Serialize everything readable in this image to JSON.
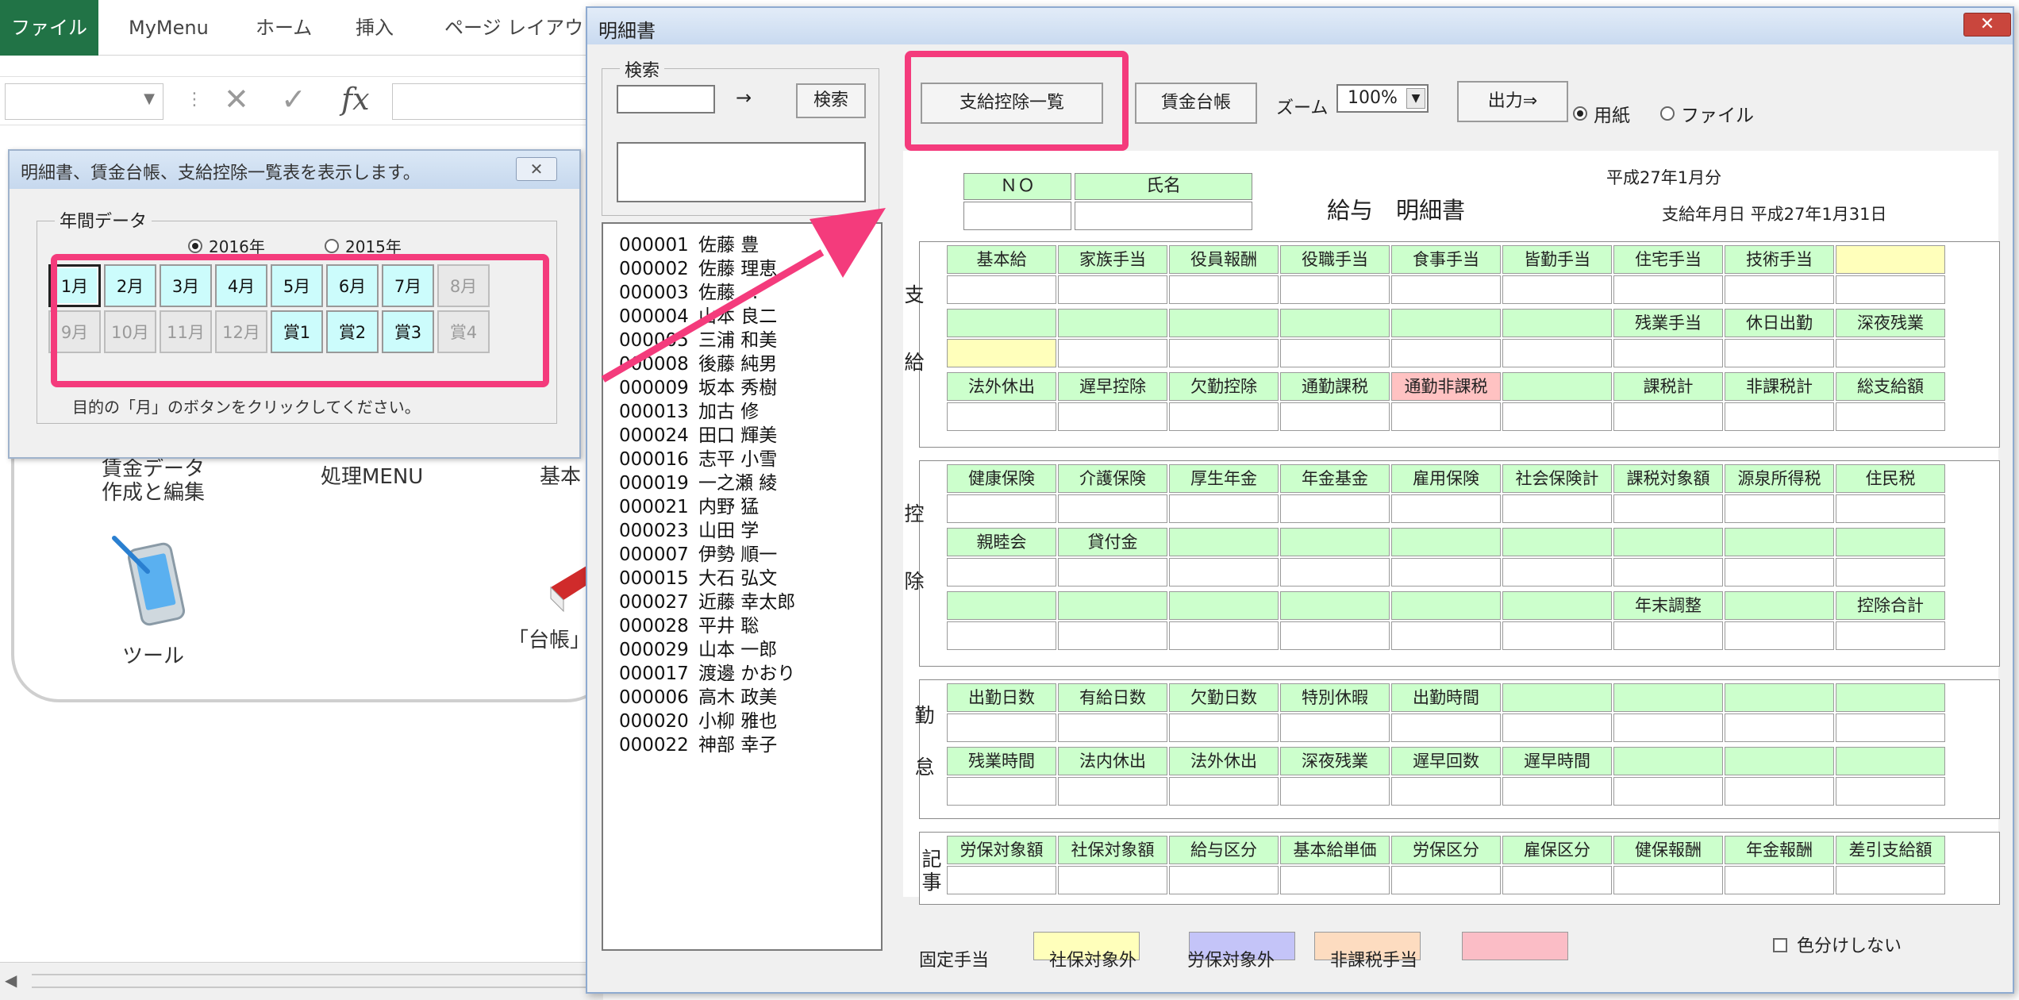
{
  "excel": {
    "ribbon_tabs": [
      "ファイル",
      "MyMenu",
      "ホーム",
      "挿入",
      "ページ レイアウト"
    ],
    "fx_label": "fx",
    "menu_items": {
      "data_edit_line1": "賃金データ",
      "data_edit_line2": "作成と編集",
      "process_menu": "処理MENU",
      "basic_partial": "基本",
      "tool": "ツール",
      "ledger_partial": "「台帳」"
    }
  },
  "small_dialog": {
    "title": "明細書、賃金台帳、支給控除一覧表を表示します。",
    "close_symbol": "✕",
    "group_label": "年間データ",
    "years": [
      {
        "label": "2016年",
        "selected": true
      },
      {
        "label": "2015年",
        "selected": false
      }
    ],
    "months": [
      {
        "label": "1月",
        "enabled": true,
        "selected": true
      },
      {
        "label": "2月",
        "enabled": true,
        "selected": false
      },
      {
        "label": "3月",
        "enabled": true,
        "selected": false
      },
      {
        "label": "4月",
        "enabled": true,
        "selected": false
      },
      {
        "label": "5月",
        "enabled": true,
        "selected": false
      },
      {
        "label": "6月",
        "enabled": true,
        "selected": false
      },
      {
        "label": "7月",
        "enabled": true,
        "selected": false
      },
      {
        "label": "8月",
        "enabled": false,
        "selected": false
      },
      {
        "label": "9月",
        "enabled": false,
        "selected": false
      },
      {
        "label": "10月",
        "enabled": false,
        "selected": false
      },
      {
        "label": "11月",
        "enabled": false,
        "selected": false
      },
      {
        "label": "12月",
        "enabled": false,
        "selected": false
      },
      {
        "label": "賞1",
        "enabled": true,
        "selected": false
      },
      {
        "label": "賞2",
        "enabled": true,
        "selected": false
      },
      {
        "label": "賞3",
        "enabled": true,
        "selected": false
      },
      {
        "label": "賞4",
        "enabled": false,
        "selected": false
      }
    ],
    "hint": "目的の「月」のボタンをクリックしてください。"
  },
  "main_form": {
    "title": "明細書",
    "close_symbol": "✕",
    "search": {
      "group_label": "検索",
      "arrow": "→",
      "button": "検索"
    },
    "employees": [
      {
        "code": "000001",
        "name": "佐藤 豊"
      },
      {
        "code": "000002",
        "name": "佐藤 理恵"
      },
      {
        "code": "000003",
        "name": "佐藤 ..."
      },
      {
        "code": "000004",
        "name": "山本 良二"
      },
      {
        "code": "000005",
        "name": "三浦 和美"
      },
      {
        "code": "000008",
        "name": "後藤 純男"
      },
      {
        "code": "000009",
        "name": "坂本 秀樹"
      },
      {
        "code": "000013",
        "name": "加古 修"
      },
      {
        "code": "000024",
        "name": "田口 輝美"
      },
      {
        "code": "000016",
        "name": "志平 小雪"
      },
      {
        "code": "000019",
        "name": "一之瀬 綾"
      },
      {
        "code": "000021",
        "name": "内野 猛"
      },
      {
        "code": "000023",
        "name": "山田 学"
      },
      {
        "code": "000007",
        "name": "伊勢 順一"
      },
      {
        "code": "000015",
        "name": "大石 弘文"
      },
      {
        "code": "000027",
        "name": "近藤 幸太郎"
      },
      {
        "code": "000028",
        "name": "平井 聡"
      },
      {
        "code": "000029",
        "name": "山本 一郎"
      },
      {
        "code": "000017",
        "name": "渡邊 かおり"
      },
      {
        "code": "000006",
        "name": "高木 政美"
      },
      {
        "code": "000020",
        "name": "小柳 雅也"
      },
      {
        "code": "000022",
        "name": "神部 幸子"
      }
    ],
    "toolbar": {
      "summary_button": "支給控除一覧",
      "ledger_button": "賃金台帳",
      "zoom_label": "ズーム",
      "zoom_value": "100%",
      "output_button": "出力⇒",
      "output_options": [
        {
          "label": "用紙",
          "selected": true
        },
        {
          "label": "ファイル",
          "selected": false
        }
      ]
    },
    "sheet": {
      "no_label": "ＮＯ",
      "name_label": "氏名",
      "doc_type": "給与　明細書",
      "period": "平成27年1月分",
      "pay_date": "支給年月日 平成27年1月31日",
      "sections": [
        {
          "title": "支給",
          "rows": [
            [
              {
                "t": "基本給"
              },
              {
                "t": "家族手当"
              },
              {
                "t": "役員報酬"
              },
              {
                "t": "役職手当"
              },
              {
                "t": "食事手当"
              },
              {
                "t": "皆勤手当"
              },
              {
                "t": "住宅手当"
              },
              {
                "t": "技術手当"
              },
              {
                "t": "",
                "c": "fixed"
              }
            ],
            [
              {
                "t": "",
                "vc": "fixed"
              },
              {
                "t": ""
              },
              {
                "t": ""
              },
              {
                "t": ""
              },
              {
                "t": ""
              },
              {
                "t": ""
              },
              {
                "t": "残業手当"
              },
              {
                "t": "休日出勤"
              },
              {
                "t": "深夜残業"
              }
            ],
            [
              {
                "t": "法外休出"
              },
              {
                "t": "遅早控除"
              },
              {
                "t": "欠勤控除"
              },
              {
                "t": "通勤課税"
              },
              {
                "t": "通勤非課税",
                "c": "nontax"
              },
              {
                "t": ""
              },
              {
                "t": "課税計"
              },
              {
                "t": "非課税計"
              },
              {
                "t": "総支給額"
              }
            ]
          ]
        },
        {
          "title": "控除",
          "rows": [
            [
              {
                "t": "健康保険"
              },
              {
                "t": "介護保険"
              },
              {
                "t": "厚生年金"
              },
              {
                "t": "年金基金"
              },
              {
                "t": "雇用保険"
              },
              {
                "t": "社会保険計"
              },
              {
                "t": "課税対象額"
              },
              {
                "t": "源泉所得税"
              },
              {
                "t": "住民税"
              }
            ],
            [
              {
                "t": "親睦会"
              },
              {
                "t": "貸付金"
              },
              {
                "t": ""
              },
              {
                "t": ""
              },
              {
                "t": ""
              },
              {
                "t": ""
              },
              {
                "t": ""
              },
              {
                "t": ""
              },
              {
                "t": ""
              }
            ],
            [
              {
                "t": ""
              },
              {
                "t": ""
              },
              {
                "t": ""
              },
              {
                "t": ""
              },
              {
                "t": ""
              },
              {
                "t": ""
              },
              {
                "t": "年末調整"
              },
              {
                "t": ""
              },
              {
                "t": "控除合計"
              }
            ]
          ]
        },
        {
          "title": "勤怠",
          "rows": [
            [
              {
                "t": "出勤日数"
              },
              {
                "t": "有給日数"
              },
              {
                "t": "欠勤日数"
              },
              {
                "t": "特別休暇"
              },
              {
                "t": "出勤時間"
              },
              {
                "t": ""
              },
              {
                "t": ""
              },
              {
                "t": ""
              },
              {
                "t": ""
              }
            ],
            [
              {
                "t": "残業時間"
              },
              {
                "t": "法内休出"
              },
              {
                "t": "法外休出"
              },
              {
                "t": "深夜残業"
              },
              {
                "t": "遅早回数"
              },
              {
                "t": "遅早時間"
              },
              {
                "t": ""
              },
              {
                "t": ""
              },
              {
                "t": ""
              }
            ]
          ]
        },
        {
          "title": "記事",
          "rows": [
            [
              {
                "t": "労保対象額"
              },
              {
                "t": "社保対象額"
              },
              {
                "t": "給与区分"
              },
              {
                "t": "基本給単価"
              },
              {
                "t": "労保区分"
              },
              {
                "t": "雇保区分"
              },
              {
                "t": "健保報酬"
              },
              {
                "t": "年金報酬"
              },
              {
                "t": "差引支給額"
              }
            ]
          ]
        }
      ]
    },
    "legend": {
      "items": [
        {
          "label": "固定手当",
          "color": "#ffffbb"
        },
        {
          "label": "社保対象外",
          "color": "#c4c4f8"
        },
        {
          "label": "労保対象外",
          "color": "#fddcc0"
        },
        {
          "label": "非課税手当",
          "color": "#fbbdc6"
        }
      ],
      "no_color_label": "色分けしない"
    }
  },
  "colors": {
    "highlight": "#f43b7c",
    "excel_green": "#217346",
    "label_green": "#ccffcc",
    "month_button": "#ccfcfc"
  }
}
